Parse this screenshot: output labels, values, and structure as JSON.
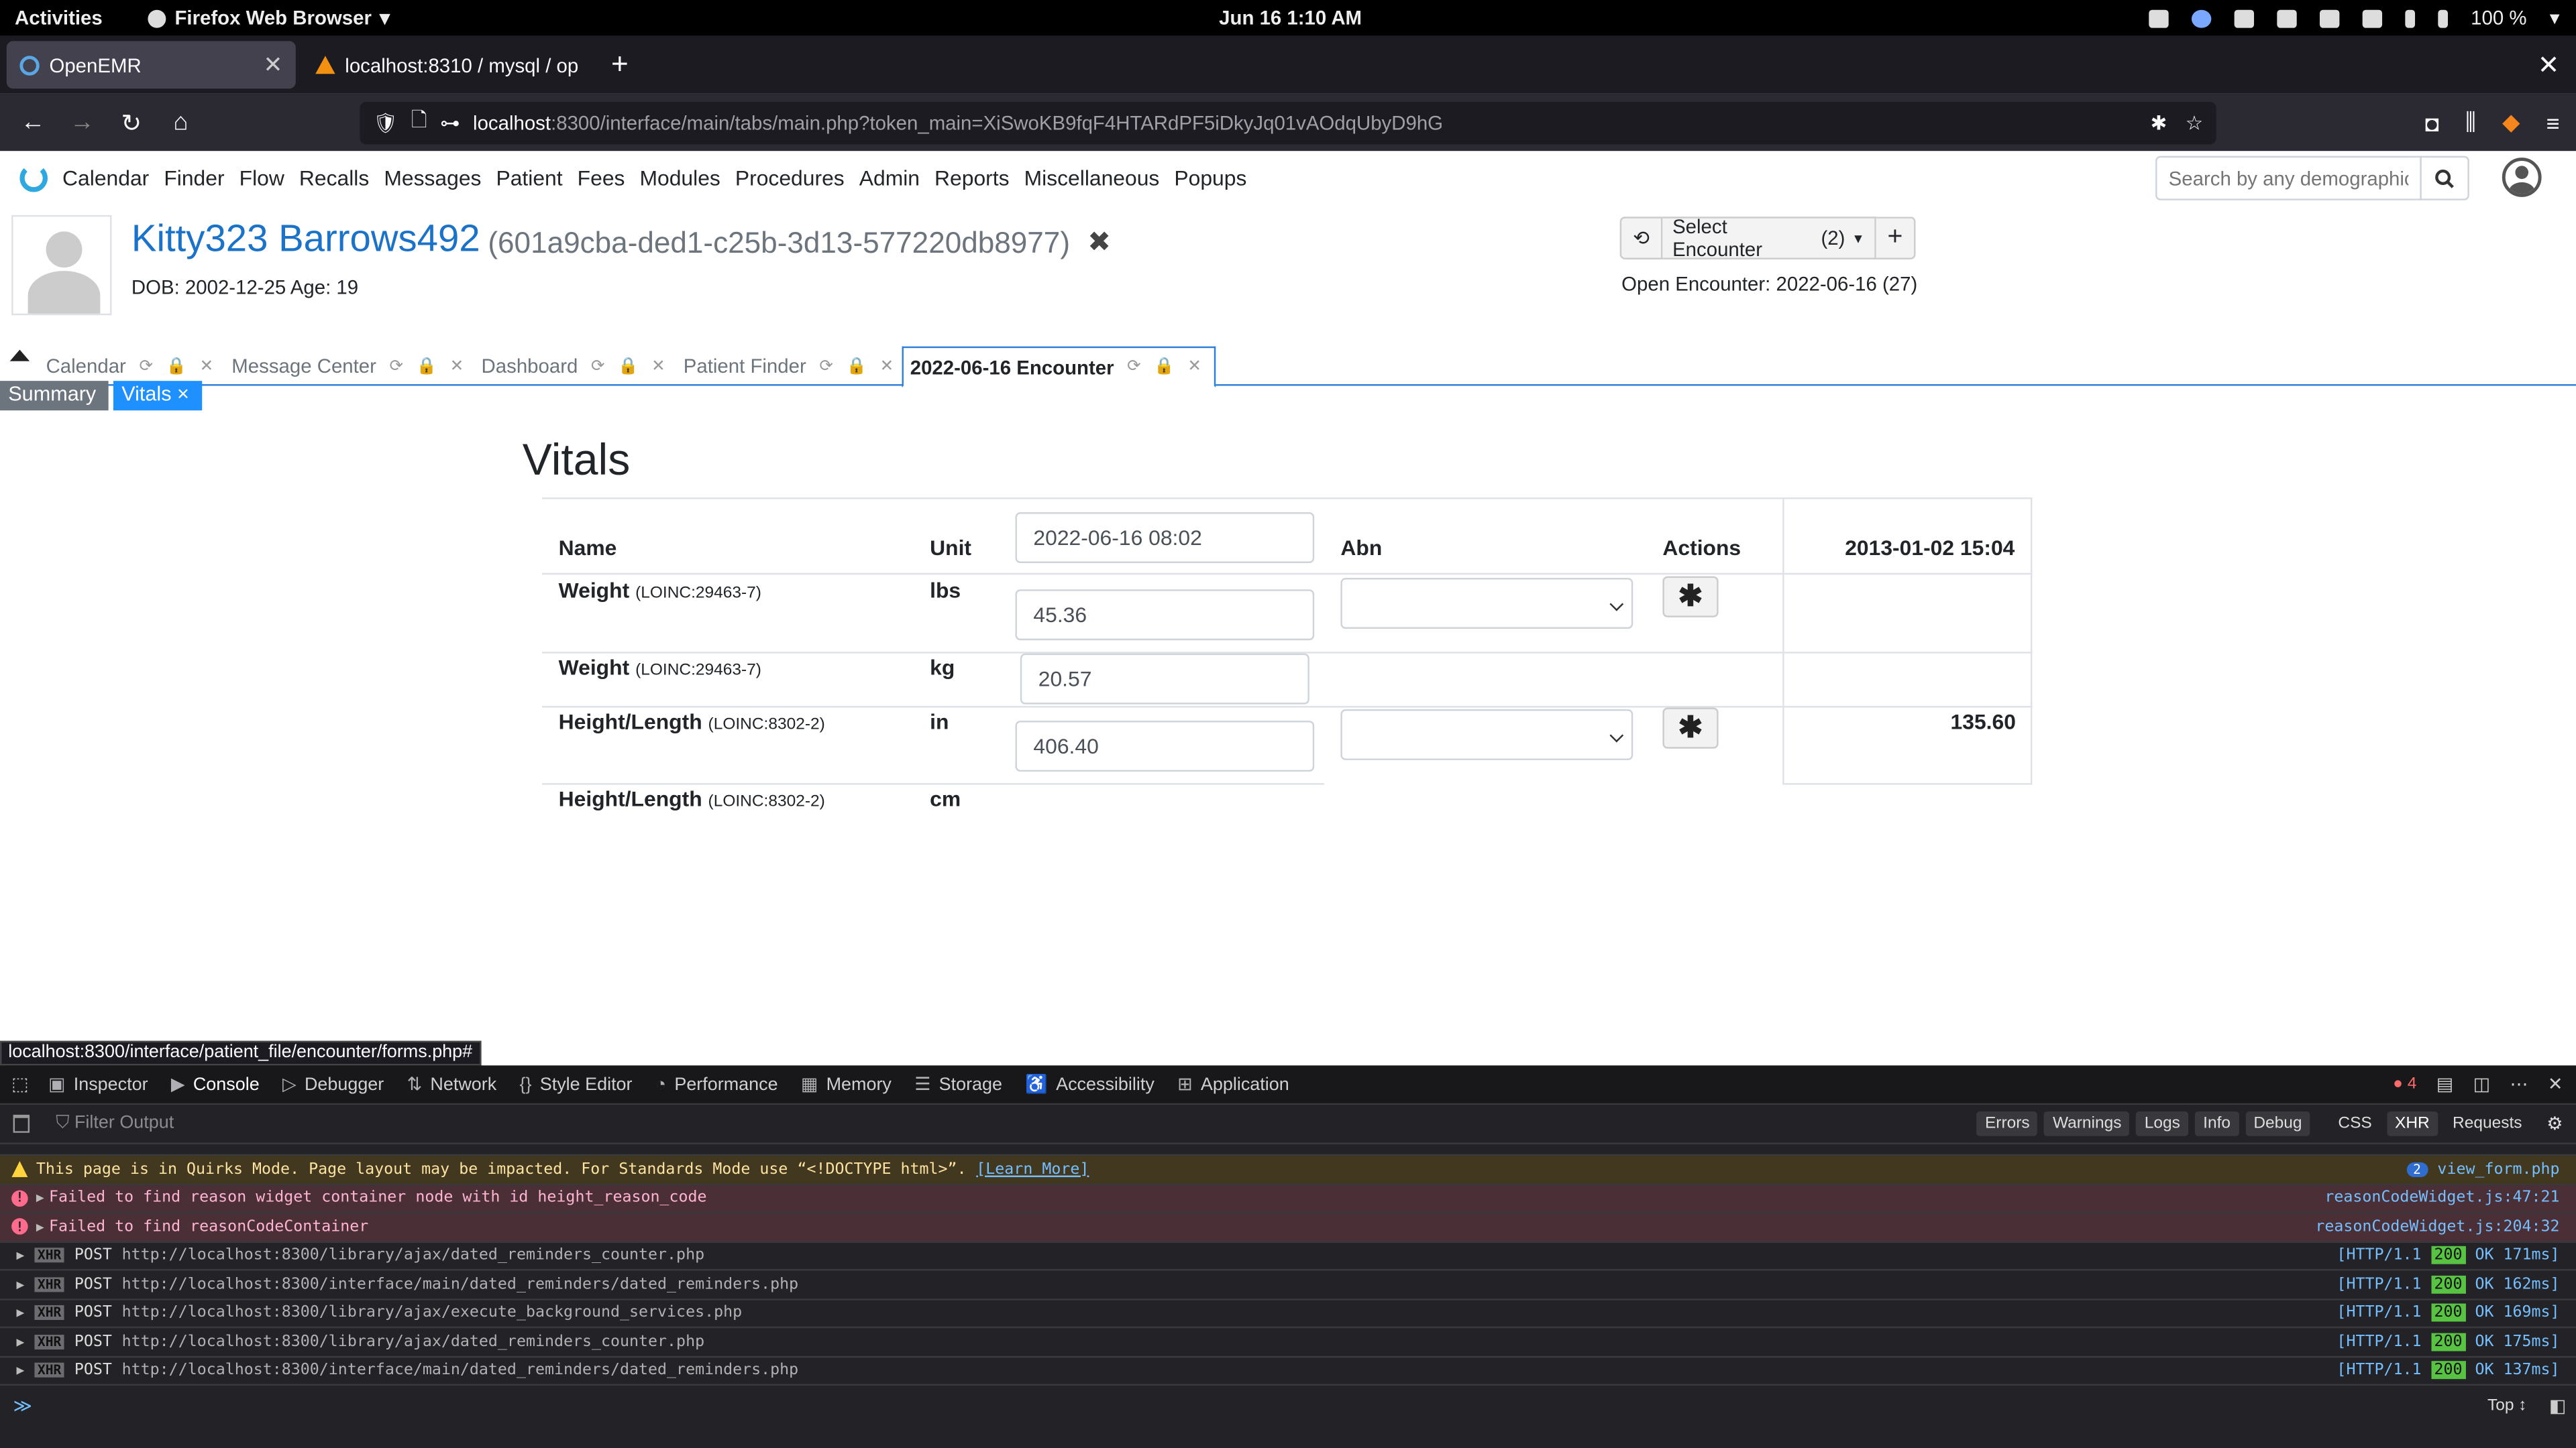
{
  "gnome": {
    "activities": "Activities",
    "app": "Firefox Web Browser",
    "clock": "Jun 16  1:10 AM",
    "battery": "100 %"
  },
  "browser": {
    "tabs": [
      {
        "label": "OpenEMR"
      },
      {
        "label": "localhost:8310 / mysql / op"
      }
    ],
    "url_host": "localhost",
    "url_path": ":8300/interface/main/tabs/main.php?token_main=XiSwoKB9fqF4HTARdPF5iDkyJq01vAOdqUbyD9hG"
  },
  "menu": {
    "items": [
      "Calendar",
      "Finder",
      "Flow",
      "Recalls",
      "Messages",
      "Patient",
      "Fees",
      "Modules",
      "Procedures",
      "Admin",
      "Reports",
      "Miscellaneous",
      "Popups"
    ],
    "search_placeholder": "Search by any demographics"
  },
  "patient": {
    "name": "Kitty323 Barrows492",
    "uuid": "(601a9cba-ded1-c25b-3d13-577220db8977)",
    "dob": "DOB: 2002-12-25 Age: 19",
    "select_encounter": "Select Encounter",
    "encounter_count": "(2)",
    "open_encounter": "Open Encounter: 2022-06-16 (27)"
  },
  "app_tabs": [
    "Calendar",
    "Message Center",
    "Dashboard",
    "Patient Finder",
    "2022-06-16 Encounter"
  ],
  "subtabs": {
    "summary": "Summary",
    "vitals": "Vitals ×"
  },
  "vitals": {
    "title": "Vitals",
    "headers": {
      "name": "Name",
      "unit": "Unit",
      "date": "2022-06-16 08:02",
      "abn": "Abn",
      "actions": "Actions",
      "history": "2013-01-02 15:04"
    },
    "rows": [
      {
        "name": "Weight",
        "code": "(LOINC:29463-7)",
        "unit": "lbs",
        "value": "45.36",
        "history": ""
      },
      {
        "name": "Weight",
        "code": "(LOINC:29463-7)",
        "unit": "kg",
        "value": "20.57",
        "history": ""
      },
      {
        "name": "Height/Length",
        "code": "(LOINC:8302-2)",
        "unit": "in",
        "value": "406.40",
        "history": "135.60"
      },
      {
        "name": "Height/Length",
        "code": "(LOINC:8302-2)",
        "unit": "cm",
        "value": "",
        "history": ""
      }
    ]
  },
  "status_url": "localhost:8300/interface/patient_file/encounter/forms.php#",
  "devtools": {
    "tabs": [
      "Inspector",
      "Console",
      "Debugger",
      "Network",
      "Style Editor",
      "Performance",
      "Memory",
      "Storage",
      "Accessibility",
      "Application"
    ],
    "error_count": "4",
    "filter_placeholder": "Filter Output",
    "filters": [
      "Errors",
      "Warnings",
      "Logs",
      "Info",
      "Debug",
      "CSS",
      "XHR",
      "Requests"
    ],
    "warning": {
      "text": "This page is in Quirks Mode. Page layout may be impacted. For Standards Mode use “<!DOCTYPE html>”.",
      "link": "[Learn More]",
      "count": "2",
      "source": "view_form.php"
    },
    "errors": [
      {
        "text": "Failed to find reason widget container node with id height_reason_code",
        "source": "reasonCodeWidget.js:47:21"
      },
      {
        "text": "Failed to find reasonCodeContainer",
        "source": "reasonCodeWidget.js:204:32"
      }
    ],
    "requests": [
      {
        "method": "POST",
        "url": "http://localhost:8300/library/ajax/dated_reminders_counter.php",
        "proto": "[HTTP/1.1",
        "status": "200",
        "timing": "OK 171ms]"
      },
      {
        "method": "POST",
        "url": "http://localhost:8300/interface/main/dated_reminders/dated_reminders.php",
        "proto": "[HTTP/1.1",
        "status": "200",
        "timing": "OK 162ms]"
      },
      {
        "method": "POST",
        "url": "http://localhost:8300/library/ajax/execute_background_services.php",
        "proto": "[HTTP/1.1",
        "status": "200",
        "timing": "OK 169ms]"
      },
      {
        "method": "POST",
        "url": "http://localhost:8300/library/ajax/dated_reminders_counter.php",
        "proto": "[HTTP/1.1",
        "status": "200",
        "timing": "OK 175ms]"
      },
      {
        "method": "POST",
        "url": "http://localhost:8300/interface/main/dated_reminders/dated_reminders.php",
        "proto": "[HTTP/1.1",
        "status": "200",
        "timing": "OK 137ms]"
      }
    ],
    "xhr_label": "XHR",
    "context": "Top ↕"
  },
  "colors": {
    "accent": "#1a73c8",
    "tab_blue": "#2e7fd6",
    "vitals_tab": "#1e90ff"
  }
}
